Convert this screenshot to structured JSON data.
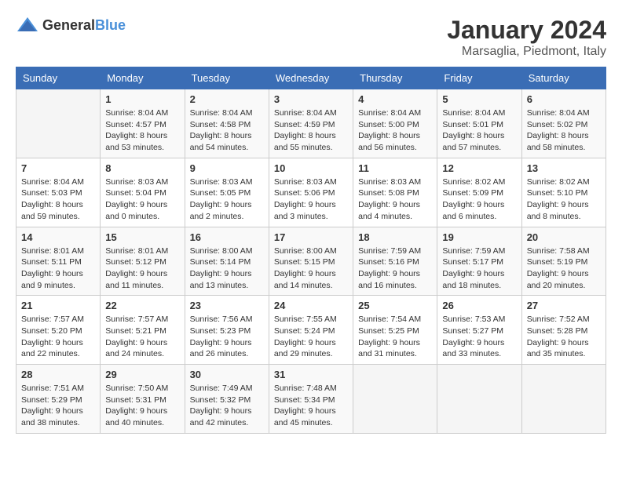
{
  "logo": {
    "general": "General",
    "blue": "Blue"
  },
  "title": "January 2024",
  "subtitle": "Marsaglia, Piedmont, Italy",
  "days_of_week": [
    "Sunday",
    "Monday",
    "Tuesday",
    "Wednesday",
    "Thursday",
    "Friday",
    "Saturday"
  ],
  "weeks": [
    [
      {
        "day": "",
        "sunrise": "",
        "sunset": "",
        "daylight": ""
      },
      {
        "day": "1",
        "sunrise": "Sunrise: 8:04 AM",
        "sunset": "Sunset: 4:57 PM",
        "daylight": "Daylight: 8 hours and 53 minutes."
      },
      {
        "day": "2",
        "sunrise": "Sunrise: 8:04 AM",
        "sunset": "Sunset: 4:58 PM",
        "daylight": "Daylight: 8 hours and 54 minutes."
      },
      {
        "day": "3",
        "sunrise": "Sunrise: 8:04 AM",
        "sunset": "Sunset: 4:59 PM",
        "daylight": "Daylight: 8 hours and 55 minutes."
      },
      {
        "day": "4",
        "sunrise": "Sunrise: 8:04 AM",
        "sunset": "Sunset: 5:00 PM",
        "daylight": "Daylight: 8 hours and 56 minutes."
      },
      {
        "day": "5",
        "sunrise": "Sunrise: 8:04 AM",
        "sunset": "Sunset: 5:01 PM",
        "daylight": "Daylight: 8 hours and 57 minutes."
      },
      {
        "day": "6",
        "sunrise": "Sunrise: 8:04 AM",
        "sunset": "Sunset: 5:02 PM",
        "daylight": "Daylight: 8 hours and 58 minutes."
      }
    ],
    [
      {
        "day": "7",
        "sunrise": "Sunrise: 8:04 AM",
        "sunset": "Sunset: 5:03 PM",
        "daylight": "Daylight: 8 hours and 59 minutes."
      },
      {
        "day": "8",
        "sunrise": "Sunrise: 8:03 AM",
        "sunset": "Sunset: 5:04 PM",
        "daylight": "Daylight: 9 hours and 0 minutes."
      },
      {
        "day": "9",
        "sunrise": "Sunrise: 8:03 AM",
        "sunset": "Sunset: 5:05 PM",
        "daylight": "Daylight: 9 hours and 2 minutes."
      },
      {
        "day": "10",
        "sunrise": "Sunrise: 8:03 AM",
        "sunset": "Sunset: 5:06 PM",
        "daylight": "Daylight: 9 hours and 3 minutes."
      },
      {
        "day": "11",
        "sunrise": "Sunrise: 8:03 AM",
        "sunset": "Sunset: 5:08 PM",
        "daylight": "Daylight: 9 hours and 4 minutes."
      },
      {
        "day": "12",
        "sunrise": "Sunrise: 8:02 AM",
        "sunset": "Sunset: 5:09 PM",
        "daylight": "Daylight: 9 hours and 6 minutes."
      },
      {
        "day": "13",
        "sunrise": "Sunrise: 8:02 AM",
        "sunset": "Sunset: 5:10 PM",
        "daylight": "Daylight: 9 hours and 8 minutes."
      }
    ],
    [
      {
        "day": "14",
        "sunrise": "Sunrise: 8:01 AM",
        "sunset": "Sunset: 5:11 PM",
        "daylight": "Daylight: 9 hours and 9 minutes."
      },
      {
        "day": "15",
        "sunrise": "Sunrise: 8:01 AM",
        "sunset": "Sunset: 5:12 PM",
        "daylight": "Daylight: 9 hours and 11 minutes."
      },
      {
        "day": "16",
        "sunrise": "Sunrise: 8:00 AM",
        "sunset": "Sunset: 5:14 PM",
        "daylight": "Daylight: 9 hours and 13 minutes."
      },
      {
        "day": "17",
        "sunrise": "Sunrise: 8:00 AM",
        "sunset": "Sunset: 5:15 PM",
        "daylight": "Daylight: 9 hours and 14 minutes."
      },
      {
        "day": "18",
        "sunrise": "Sunrise: 7:59 AM",
        "sunset": "Sunset: 5:16 PM",
        "daylight": "Daylight: 9 hours and 16 minutes."
      },
      {
        "day": "19",
        "sunrise": "Sunrise: 7:59 AM",
        "sunset": "Sunset: 5:17 PM",
        "daylight": "Daylight: 9 hours and 18 minutes."
      },
      {
        "day": "20",
        "sunrise": "Sunrise: 7:58 AM",
        "sunset": "Sunset: 5:19 PM",
        "daylight": "Daylight: 9 hours and 20 minutes."
      }
    ],
    [
      {
        "day": "21",
        "sunrise": "Sunrise: 7:57 AM",
        "sunset": "Sunset: 5:20 PM",
        "daylight": "Daylight: 9 hours and 22 minutes."
      },
      {
        "day": "22",
        "sunrise": "Sunrise: 7:57 AM",
        "sunset": "Sunset: 5:21 PM",
        "daylight": "Daylight: 9 hours and 24 minutes."
      },
      {
        "day": "23",
        "sunrise": "Sunrise: 7:56 AM",
        "sunset": "Sunset: 5:23 PM",
        "daylight": "Daylight: 9 hours and 26 minutes."
      },
      {
        "day": "24",
        "sunrise": "Sunrise: 7:55 AM",
        "sunset": "Sunset: 5:24 PM",
        "daylight": "Daylight: 9 hours and 29 minutes."
      },
      {
        "day": "25",
        "sunrise": "Sunrise: 7:54 AM",
        "sunset": "Sunset: 5:25 PM",
        "daylight": "Daylight: 9 hours and 31 minutes."
      },
      {
        "day": "26",
        "sunrise": "Sunrise: 7:53 AM",
        "sunset": "Sunset: 5:27 PM",
        "daylight": "Daylight: 9 hours and 33 minutes."
      },
      {
        "day": "27",
        "sunrise": "Sunrise: 7:52 AM",
        "sunset": "Sunset: 5:28 PM",
        "daylight": "Daylight: 9 hours and 35 minutes."
      }
    ],
    [
      {
        "day": "28",
        "sunrise": "Sunrise: 7:51 AM",
        "sunset": "Sunset: 5:29 PM",
        "daylight": "Daylight: 9 hours and 38 minutes."
      },
      {
        "day": "29",
        "sunrise": "Sunrise: 7:50 AM",
        "sunset": "Sunset: 5:31 PM",
        "daylight": "Daylight: 9 hours and 40 minutes."
      },
      {
        "day": "30",
        "sunrise": "Sunrise: 7:49 AM",
        "sunset": "Sunset: 5:32 PM",
        "daylight": "Daylight: 9 hours and 42 minutes."
      },
      {
        "day": "31",
        "sunrise": "Sunrise: 7:48 AM",
        "sunset": "Sunset: 5:34 PM",
        "daylight": "Daylight: 9 hours and 45 minutes."
      },
      {
        "day": "",
        "sunrise": "",
        "sunset": "",
        "daylight": ""
      },
      {
        "day": "",
        "sunrise": "",
        "sunset": "",
        "daylight": ""
      },
      {
        "day": "",
        "sunrise": "",
        "sunset": "",
        "daylight": ""
      }
    ]
  ]
}
